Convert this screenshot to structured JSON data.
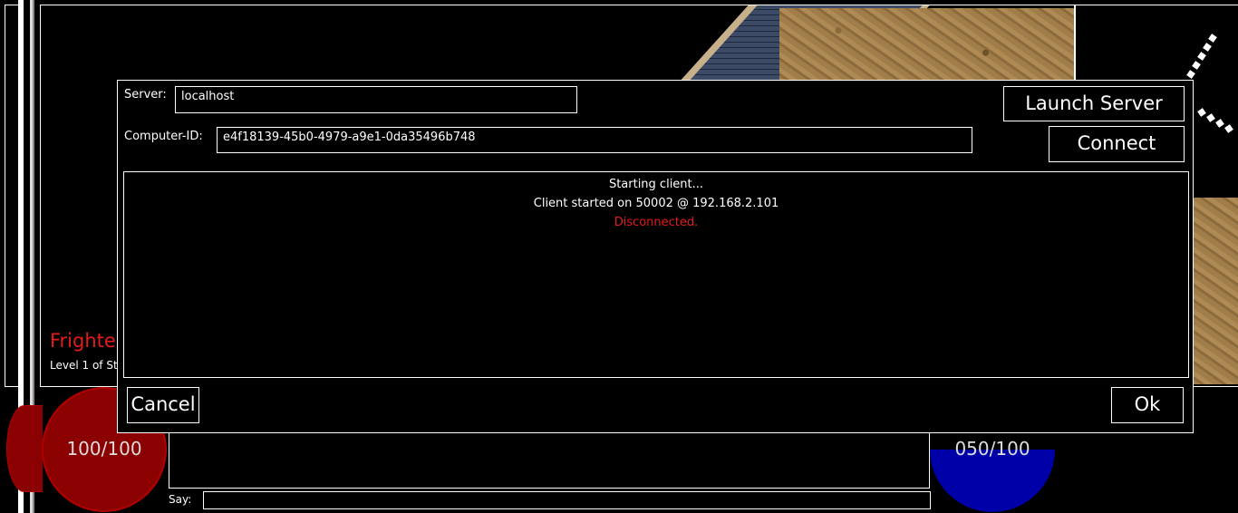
{
  "dialog": {
    "server_label": "Server:",
    "server_value": "localhost",
    "computer_id_label": "Computer-ID:",
    "computer_id_value": "e4f18139-45b0-4979-a9e1-0da35496b748",
    "launch_server_label": "Launch Server",
    "connect_label": "Connect",
    "cancel_label": "Cancel",
    "ok_label": "Ok",
    "log": [
      {
        "text": "Starting client...",
        "color": "#ffffff"
      },
      {
        "text": "Client started on 50002 @ 192.168.2.101",
        "color": "#ffffff"
      },
      {
        "text": "Disconnected.",
        "color": "#e31b1b"
      }
    ]
  },
  "hud": {
    "creature_name": "Frighte",
    "creature_level": "Level 1 of St",
    "health_text": "100/100",
    "health_fraction": 1.0,
    "mana_text": "050/100",
    "mana_fraction": 0.5,
    "say_label": "Say:",
    "colors": {
      "health": "#8b0000",
      "mana": "#0000a8",
      "alert": "#e31b1b"
    }
  }
}
